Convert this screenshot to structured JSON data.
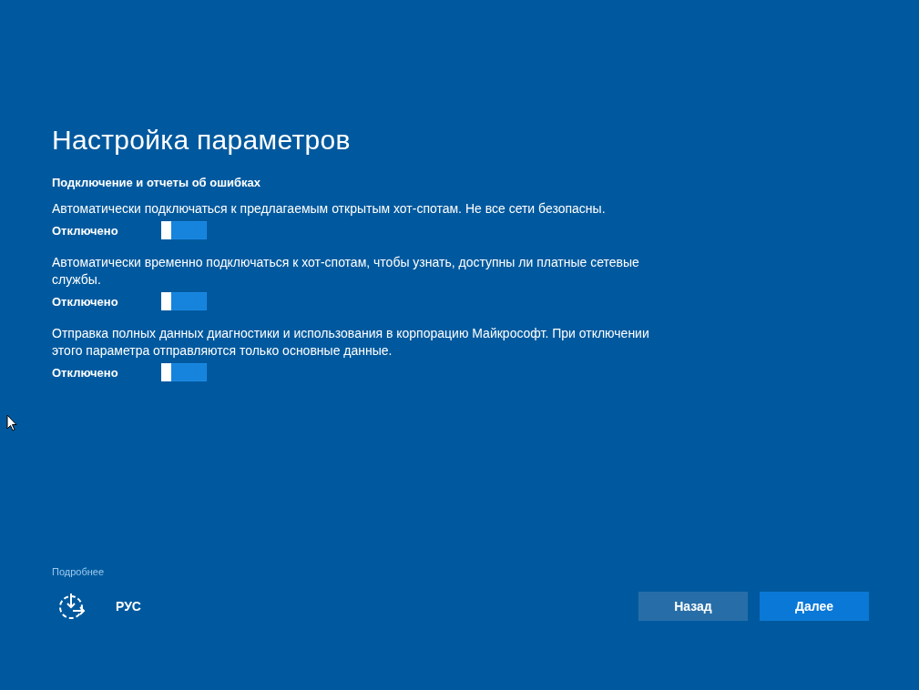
{
  "title": "Настройка параметров",
  "section": {
    "heading": "Подключение и отчеты об ошибках",
    "settings": [
      {
        "description": "Автоматически подключаться к предлагаемым открытым хот-спотам. Не все сети безопасны.",
        "state_label": "Отключено",
        "on": false
      },
      {
        "description": "Автоматически временно подключаться к хот-спотам, чтобы узнать, доступны ли платные сетевые службы.",
        "state_label": "Отключено",
        "on": false
      },
      {
        "description": "Отправка полных данных диагностики и использования в корпорацию Майкрософт. При отключении этого параметра отправляются только основные данные.",
        "state_label": "Отключено",
        "on": false
      }
    ]
  },
  "learn_more_link": "Подробнее",
  "language": "РУС",
  "buttons": [
    {
      "label": "Назад",
      "kind": "secondary"
    },
    {
      "label": "Далее",
      "kind": "primary"
    }
  ]
}
